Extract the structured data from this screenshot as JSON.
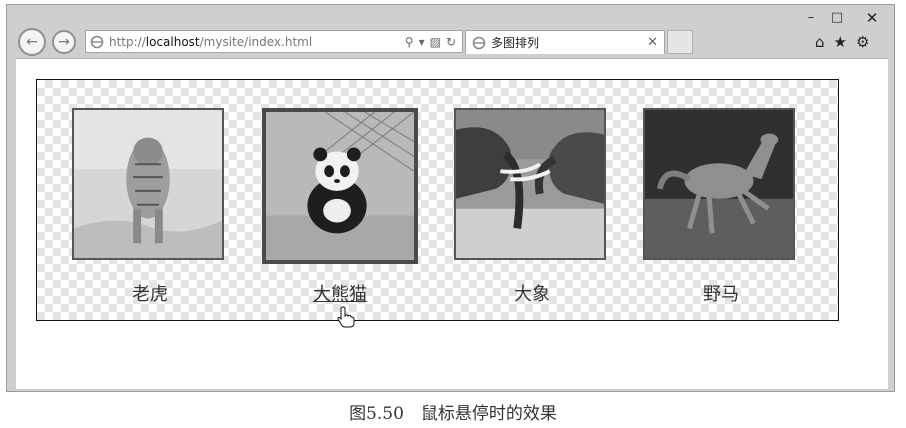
{
  "window": {
    "minimize": "–",
    "maximize": "□",
    "close": "✕"
  },
  "toolbar": {
    "back": "←",
    "forward": "→",
    "url_prefix": "http://",
    "url_host": "localhost",
    "url_path": "/mysite/index.html",
    "search_icon": "⚲",
    "dropdown_icon": "▾",
    "compat_icon": "▨",
    "refresh_icon": "↻",
    "home_icon": "⌂",
    "favorites_icon": "★",
    "settings_icon": "⚙"
  },
  "tab": {
    "title": "多图排列",
    "close": "✕"
  },
  "gallery": {
    "items": [
      {
        "label": "老虎",
        "icon": "tiger-photo",
        "hovered": false
      },
      {
        "label": "大熊猫",
        "icon": "panda-photo",
        "hovered": true
      },
      {
        "label": "大象",
        "icon": "elephants-photo",
        "hovered": false
      },
      {
        "label": "野马",
        "icon": "horse-photo",
        "hovered": false
      }
    ]
  },
  "figure_caption": "图5.50　鼠标悬停时的效果"
}
